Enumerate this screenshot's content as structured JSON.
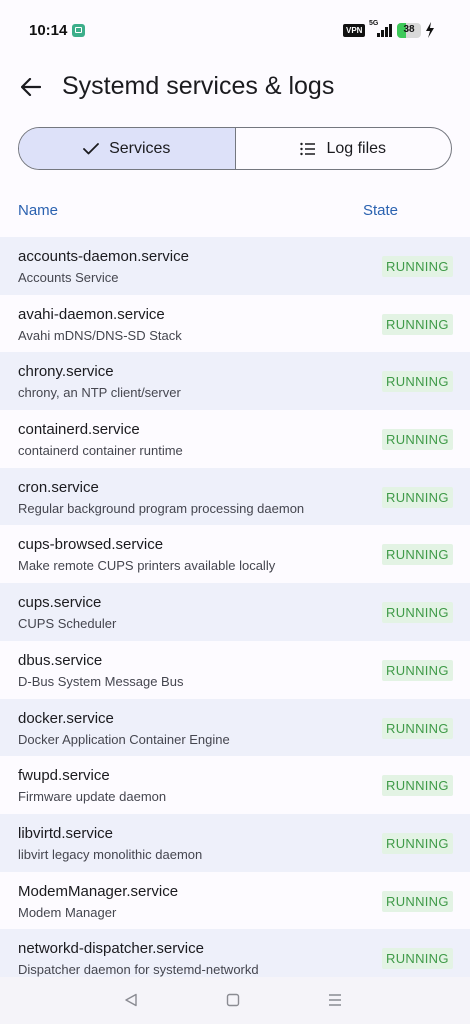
{
  "status_bar": {
    "time": "10:14",
    "vpn_label": "VPN",
    "network_label": "5G",
    "battery_level": "38",
    "battery_fraction": 0.38,
    "icons": [
      "app-notification-icon",
      "signal-icon",
      "battery-icon",
      "charging-bolt-icon"
    ]
  },
  "app_bar": {
    "back_icon": "arrow-left-icon",
    "title": "Systemd services & logs"
  },
  "tabs": {
    "services_label": "Services",
    "services_icon": "check-icon",
    "logs_label": "Log files",
    "logs_icon": "list-icon",
    "selected": "Services"
  },
  "table": {
    "col_name": "Name",
    "col_state": "State",
    "rows": [
      {
        "name": "accounts-daemon.service",
        "desc": "Accounts Service",
        "state": "RUNNING"
      },
      {
        "name": "avahi-daemon.service",
        "desc": "Avahi mDNS/DNS-SD Stack",
        "state": "RUNNING"
      },
      {
        "name": "chrony.service",
        "desc": "chrony, an NTP client/server",
        "state": "RUNNING"
      },
      {
        "name": "containerd.service",
        "desc": "containerd container runtime",
        "state": "RUNNING"
      },
      {
        "name": "cron.service",
        "desc": "Regular background program processing daemon",
        "state": "RUNNING"
      },
      {
        "name": "cups-browsed.service",
        "desc": "Make remote CUPS printers available locally",
        "state": "RUNNING"
      },
      {
        "name": "cups.service",
        "desc": "CUPS Scheduler",
        "state": "RUNNING"
      },
      {
        "name": "dbus.service",
        "desc": "D-Bus System Message Bus",
        "state": "RUNNING"
      },
      {
        "name": "docker.service",
        "desc": "Docker Application Container Engine",
        "state": "RUNNING"
      },
      {
        "name": "fwupd.service",
        "desc": "Firmware update daemon",
        "state": "RUNNING"
      },
      {
        "name": "libvirtd.service",
        "desc": "libvirt legacy monolithic daemon",
        "state": "RUNNING"
      },
      {
        "name": "ModemManager.service",
        "desc": "Modem Manager",
        "state": "RUNNING"
      },
      {
        "name": "networkd-dispatcher.service",
        "desc": "Dispatcher daemon for systemd-networkd",
        "state": "RUNNING"
      }
    ]
  },
  "nav_bar": {
    "icons": [
      "back-triangle-icon",
      "home-square-icon",
      "recents-menu-icon"
    ]
  },
  "colors": {
    "accent": "#2b62b0",
    "selected_segment": "#dde1f9",
    "row_alt": "#eef0fa",
    "running_bg": "#e3f3e4",
    "running_text": "#3f9a48",
    "battery": "#3ec95a"
  }
}
